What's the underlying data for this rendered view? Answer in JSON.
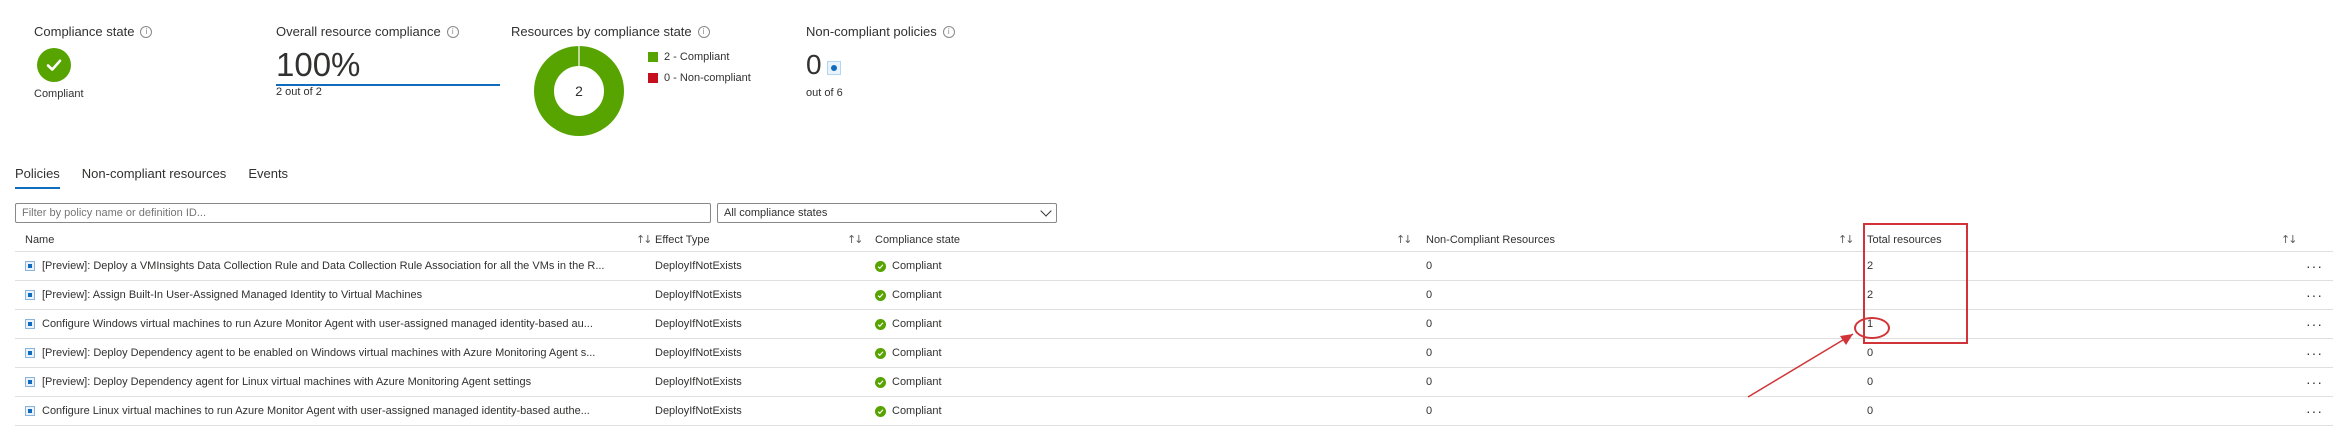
{
  "summary": {
    "state": {
      "title": "Compliance state",
      "value": "Compliant"
    },
    "overall": {
      "title": "Overall resource compliance",
      "percent": "100%",
      "sub": "2 out of 2",
      "fraction": 1.0
    },
    "donut": {
      "title": "Resources by compliance state",
      "center": "2",
      "legend": [
        {
          "label": "2 - Compliant",
          "color": "#57a300"
        },
        {
          "label": "0 - Non-compliant",
          "color": "#c50f1f"
        }
      ]
    },
    "policies": {
      "title": "Non-compliant policies",
      "value": "0",
      "sub": "out of 6"
    }
  },
  "tabs": [
    {
      "label": "Policies",
      "active": true
    },
    {
      "label": "Non-compliant resources",
      "active": false
    },
    {
      "label": "Events",
      "active": false
    }
  ],
  "filters": {
    "search_placeholder": "Filter by policy name or definition ID...",
    "state_value": "All compliance states"
  },
  "table": {
    "columns": [
      "Name",
      "Effect Type",
      "Compliance state",
      "Non-Compliant Resources",
      "Total resources"
    ],
    "rows": [
      {
        "name": "[Preview]: Deploy a VMInsights Data Collection Rule and Data Collection Rule Association for all the VMs in the R...",
        "effect": "DeployIfNotExists",
        "state": "Compliant",
        "noncompliant": "0",
        "total": "2"
      },
      {
        "name": "[Preview]: Assign Built-In User-Assigned Managed Identity to Virtual Machines",
        "effect": "DeployIfNotExists",
        "state": "Compliant",
        "noncompliant": "0",
        "total": "2"
      },
      {
        "name": "Configure Windows virtual machines to run Azure Monitor Agent with user-assigned managed identity-based au...",
        "effect": "DeployIfNotExists",
        "state": "Compliant",
        "noncompliant": "0",
        "total": "1"
      },
      {
        "name": "[Preview]: Deploy Dependency agent to be enabled on Windows virtual machines with Azure Monitoring Agent s...",
        "effect": "DeployIfNotExists",
        "state": "Compliant",
        "noncompliant": "0",
        "total": "0"
      },
      {
        "name": "[Preview]: Deploy Dependency agent for Linux virtual machines with Azure Monitoring Agent settings",
        "effect": "DeployIfNotExists",
        "state": "Compliant",
        "noncompliant": "0",
        "total": "0"
      },
      {
        "name": "Configure Linux virtual machines to run Azure Monitor Agent with user-assigned managed identity-based authe...",
        "effect": "DeployIfNotExists",
        "state": "Compliant",
        "noncompliant": "0",
        "total": "0"
      }
    ],
    "more_label": "···"
  },
  "colors": {
    "accent": "#0f6cbd",
    "success": "#57a300",
    "error": "#c50f1f",
    "annotation": "#d13438"
  }
}
